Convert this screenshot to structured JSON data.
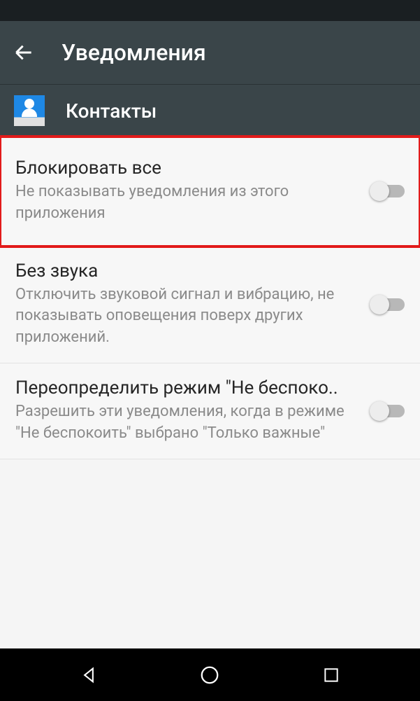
{
  "header": {
    "title": "Уведомления"
  },
  "app": {
    "name": "Контакты"
  },
  "settings": [
    {
      "title": "Блокировать все",
      "desc": "Не показывать уведомления из этого приложения",
      "enabled": false,
      "highlighted": true
    },
    {
      "title": "Без звука",
      "desc": "Отключить звуковой сигнал и вибрацию, не показывать оповещения поверх других приложений.",
      "enabled": false,
      "highlighted": false
    },
    {
      "title": "Переопределить режим \"Не беспоко..",
      "desc": "Разрешить эти уведомления, когда в режиме \"Не беспокоить\" выбрано \"Только важные\"",
      "enabled": false,
      "highlighted": false
    }
  ]
}
